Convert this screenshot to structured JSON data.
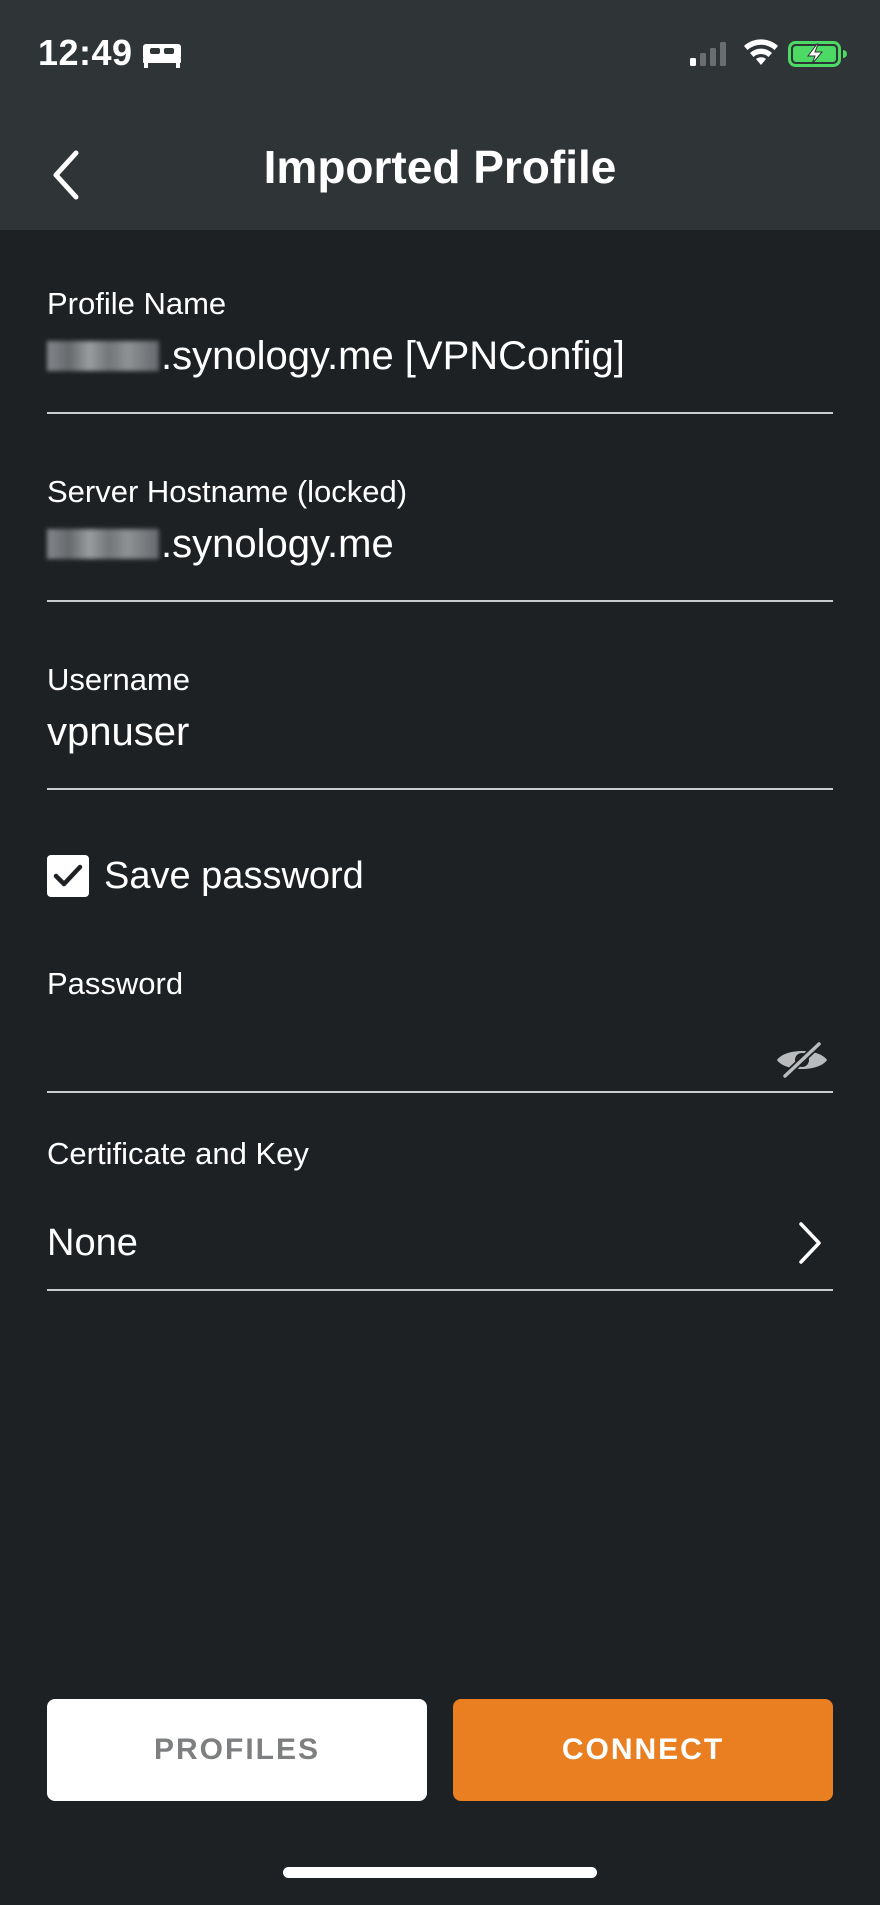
{
  "status_bar": {
    "time": "12:49",
    "icons": [
      "sleep-icon",
      "cellular-signal-icon",
      "wifi-icon",
      "battery-charging-icon"
    ],
    "battery_color": "#4cd964"
  },
  "nav": {
    "title": "Imported Profile",
    "back_icon": "chevron-left-icon"
  },
  "form": {
    "profile_name": {
      "label": "Profile Name",
      "value": ".synology.me [VPNConfig]"
    },
    "server_hostname": {
      "label": "Server Hostname (locked)",
      "value": ".synology.me"
    },
    "username": {
      "label": "Username",
      "value": "vpnuser"
    },
    "save_password": {
      "label": "Save password",
      "checked": true
    },
    "password": {
      "label": "Password",
      "value": "",
      "toggle_icon": "eye-slash-icon"
    },
    "certificate": {
      "label": "Certificate and Key",
      "value": "None",
      "icon": "chevron-right-icon"
    }
  },
  "buttons": {
    "profiles": "PROFILES",
    "connect": "CONNECT"
  },
  "colors": {
    "background": "#1e2124",
    "header": "#2f3437",
    "accent": "#ea7f22",
    "divider": "#c9cbcc"
  }
}
